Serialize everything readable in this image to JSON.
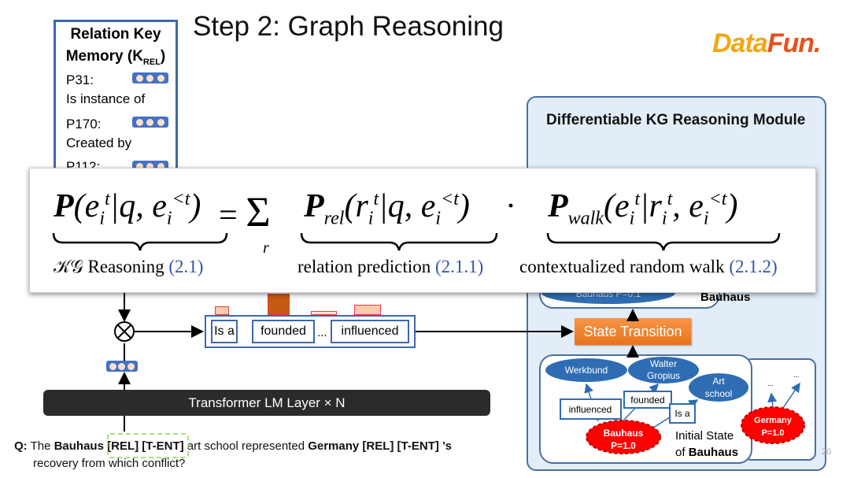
{
  "slide": {
    "title": "Step 2: Graph Reasoning",
    "page_number": "20"
  },
  "logo": {
    "text_a": "Data",
    "text_b": "Fun."
  },
  "relation_memory": {
    "title_line1": "Relation Key",
    "title_line2": "Memory (K",
    "title_sub": "REL",
    "title_close": ")",
    "items": [
      {
        "id": "P31:",
        "label": "Is instance of"
      },
      {
        "id": "P170:",
        "label": "Created by"
      },
      {
        "id": "P112:",
        "label": ""
      }
    ]
  },
  "formula": {
    "lhs": "P(e_i^t | q, e_i^{<t})",
    "sum": "= Σ_r",
    "rel": "P_rel(r_i^t | q, e_i^{<t})",
    "dot": "·",
    "walk": "P_walk(e_i^t | r_i^t, e_i^{<t})",
    "label_lhs": "𝒦𝒢 Reasoning",
    "label_lhs_num": "(2.1)",
    "label_rel": "relation prediction",
    "label_rel_num": "(2.1.1)",
    "label_walk": "contextualized random walk",
    "label_walk_num": "(2.1.2)"
  },
  "relations": {
    "items": [
      "Is a",
      "founded",
      "influenced"
    ],
    "ellipsis": "...",
    "scores": [
      0.3,
      0.75,
      0.15,
      0.35
    ]
  },
  "transformer": {
    "label": "Transformer LM Layer × N"
  },
  "question": {
    "prefix": "Q:",
    "w1": " The ",
    "b1": "Bauhaus",
    "b2": " [REL] [T-ENT]",
    "w2": " art school represented ",
    "b3": "Germany [REL] [T-ENT] ’s",
    "line2": "recovery from which conflict?"
  },
  "module": {
    "title": "Differentiable KG Reasoning Module",
    "top_node": "Bauhaus P=0.1",
    "top_label": "Bauhaus",
    "state_transition": "State Transition",
    "initial": {
      "nodes": [
        "Werkbund",
        "Walter",
        "Gropius",
        "Art",
        "school"
      ],
      "edges": [
        "influenced",
        "founded",
        "Is a"
      ],
      "source": "Bauhaus",
      "source_p": "P=1.0",
      "caption1": "Initial State",
      "caption2": "of ",
      "caption_bold": "Bauhaus"
    },
    "second": {
      "source": "Germany",
      "source_p": "P=1.0",
      "dots": "..."
    }
  },
  "colors": {
    "accent_blue": "#3f67ad",
    "module_bg": "#e3edf7",
    "orange": "#f79646",
    "red_node": "#ff0000",
    "node_blue": "#2e6db4"
  }
}
